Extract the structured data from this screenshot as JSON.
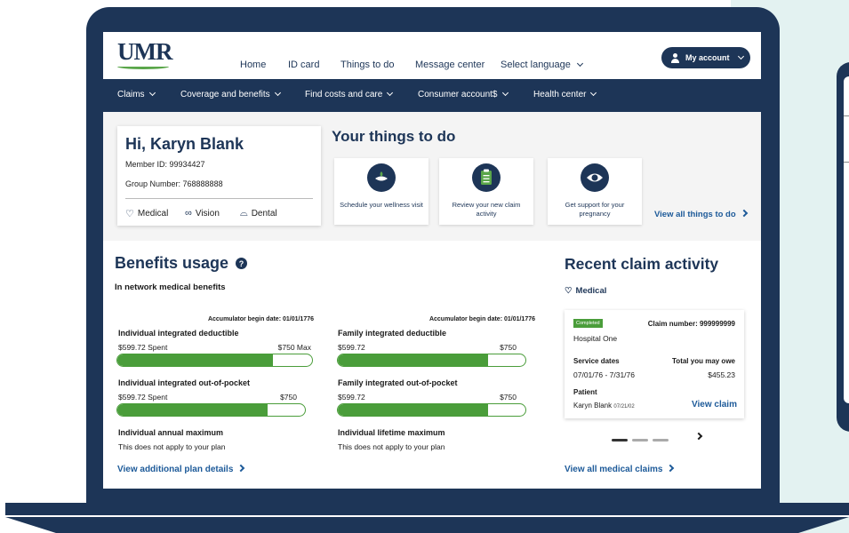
{
  "header": {
    "logo": "UMR",
    "nav": [
      "Home",
      "ID card",
      "Things to do",
      "Message center",
      "Select language"
    ],
    "account_label": "My account"
  },
  "menu": [
    "Claims",
    "Coverage and benefits",
    "Find costs and care",
    "Consumer account$",
    "Health center"
  ],
  "member": {
    "greeting": "Hi, Karyn Blank",
    "member_id": "Member ID: 99934427",
    "group_number": "Group Number:  768888888",
    "coverage": [
      "Medical",
      "Vision",
      "Dental"
    ]
  },
  "things_to_do": {
    "title": "Your things to do",
    "tasks": [
      {
        "label": "Schedule your wellness visit",
        "icon": "wellness-icon"
      },
      {
        "label": "Review your new claim activity",
        "icon": "clipboard-icon"
      },
      {
        "label": "Get support for your pregnancy",
        "icon": "pregnancy-icon"
      }
    ],
    "view_all": "View all things to do"
  },
  "benefits": {
    "title": "Benefits usage",
    "subtitle": "In network medical benefits",
    "columns": [
      {
        "accumulator": "Accumulator begin date: 01/01/1776",
        "items": [
          {
            "label": "Individual integrated deductible",
            "spent": "$599.72 Spent",
            "max": "$750 Max",
            "progress": 0.8
          },
          {
            "label": "Individual integrated out-of-pocket",
            "spent": "$599.72 Spent",
            "max": "$750",
            "progress": 0.8
          },
          {
            "label": "Individual annual maximum",
            "note": "This does not apply to your plan"
          }
        ]
      },
      {
        "accumulator": "Accumulator begin date: 01/01/1776",
        "items": [
          {
            "label": "Family integrated deductible",
            "spent": "$599.72",
            "max": "$750",
            "progress": 0.8
          },
          {
            "label": "Family integrated out-of-pocket",
            "spent": "$599.72",
            "max": "$750",
            "progress": 0.8
          },
          {
            "label": "Individual lifetime maximum",
            "note": "This does not apply to your plan"
          }
        ]
      }
    ],
    "view_details": "View additional plan details"
  },
  "claims": {
    "title": "Recent claim activity",
    "category": "Medical",
    "card": {
      "status": "Completed",
      "claim_number": "Claim number:  999999999",
      "provider": "Hospital One",
      "service_dates_label": "Service dates",
      "service_dates": "07/01/76 - 7/31/76",
      "owe_label": "Total you may owe",
      "owe": "$455.23",
      "patient_label": "Patient",
      "patient": "Karyn Blank",
      "patient_dob": "07/21/02",
      "view_claim": "View claim"
    },
    "view_all": "View all medical claims"
  },
  "colors": {
    "navy": "#1d3557",
    "green": "#4a9d3a",
    "link": "#1d5a99"
  }
}
